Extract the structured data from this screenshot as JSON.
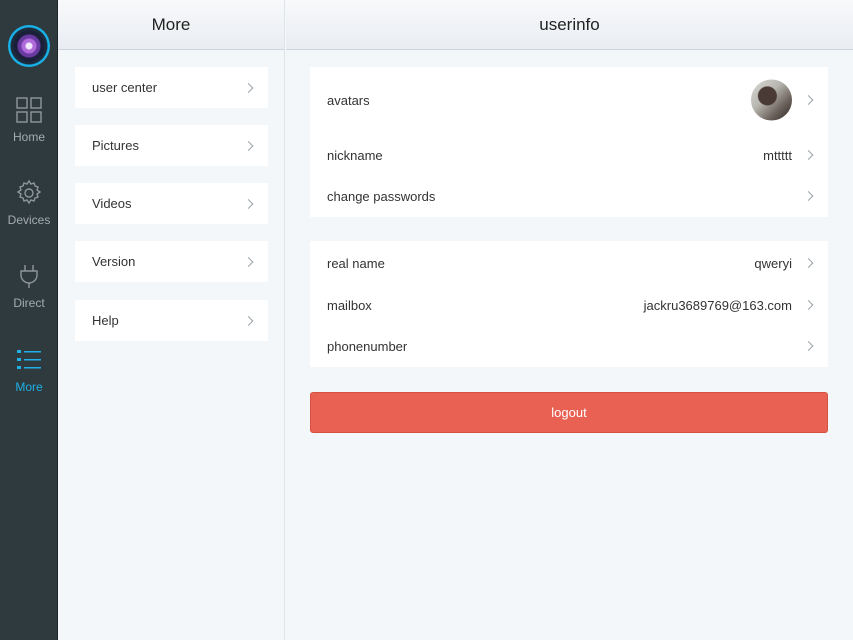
{
  "rail": {
    "items": [
      {
        "label": "Home",
        "icon": "home-grid-icon",
        "active": false
      },
      {
        "label": "Devices",
        "icon": "gear-icon",
        "active": false
      },
      {
        "label": "Direct",
        "icon": "plug-icon",
        "active": false
      },
      {
        "label": "More",
        "icon": "list-icon",
        "active": true
      }
    ],
    "active_color": "#1eb0e6"
  },
  "more_panel": {
    "title": "More",
    "items": [
      "user center",
      "Pictures",
      "Videos",
      "Version",
      "Help"
    ]
  },
  "userinfo": {
    "title": "userinfo",
    "section1": [
      {
        "label": "avatars",
        "value": ""
      },
      {
        "label": "nickname",
        "value": "mttttt"
      },
      {
        "label": "change passwords",
        "value": ""
      }
    ],
    "section2": [
      {
        "label": "real name",
        "value": "qweryi"
      },
      {
        "label": "mailbox",
        "value": "jackru3689769@163.com"
      },
      {
        "label": "phonenumber",
        "value": ""
      }
    ],
    "logout_label": "logout",
    "logout_color": "#e96153"
  }
}
